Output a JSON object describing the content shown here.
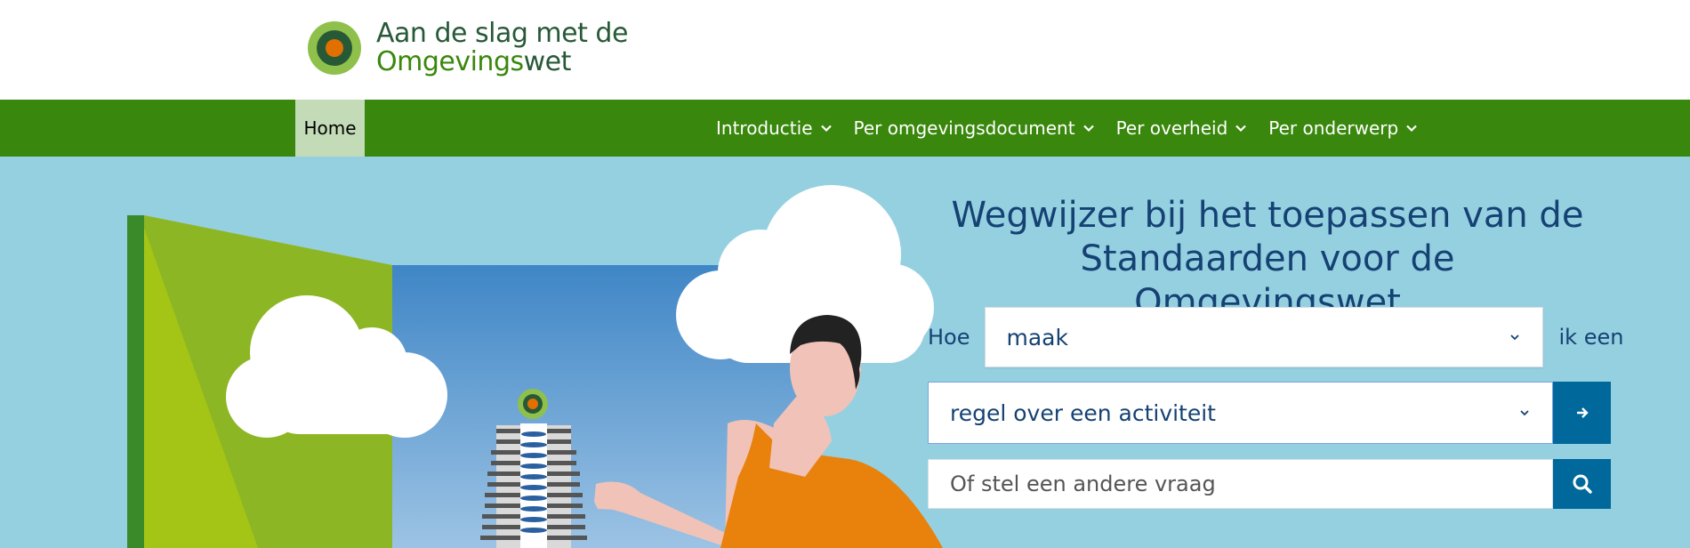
{
  "logo": {
    "line1": "Aan de slag met de",
    "line2_a": "Omgevings",
    "line2_b": "wet"
  },
  "nav": {
    "home": "Home",
    "items": [
      "Introductie",
      "Per omgevingsdocument",
      "Per overheid",
      "Per onderwerp"
    ]
  },
  "hero": {
    "title": "Wegwijzer bij het toepassen van de Standaarden voor de Omgevingswet",
    "prefix": "Hoe",
    "select1_value": "maak",
    "suffix": "ik een",
    "select2_value": "regel over een activiteit",
    "search_placeholder": "Of stel een andere vraag"
  },
  "colors": {
    "nav": "#39870c",
    "hero": "#95d0e1",
    "title": "#154273",
    "button": "#01689b",
    "home_active": "#c3dbb6"
  },
  "icons": [
    "logo-mark-icon",
    "chevron-down-icon",
    "arrow-right-icon",
    "search-icon"
  ]
}
